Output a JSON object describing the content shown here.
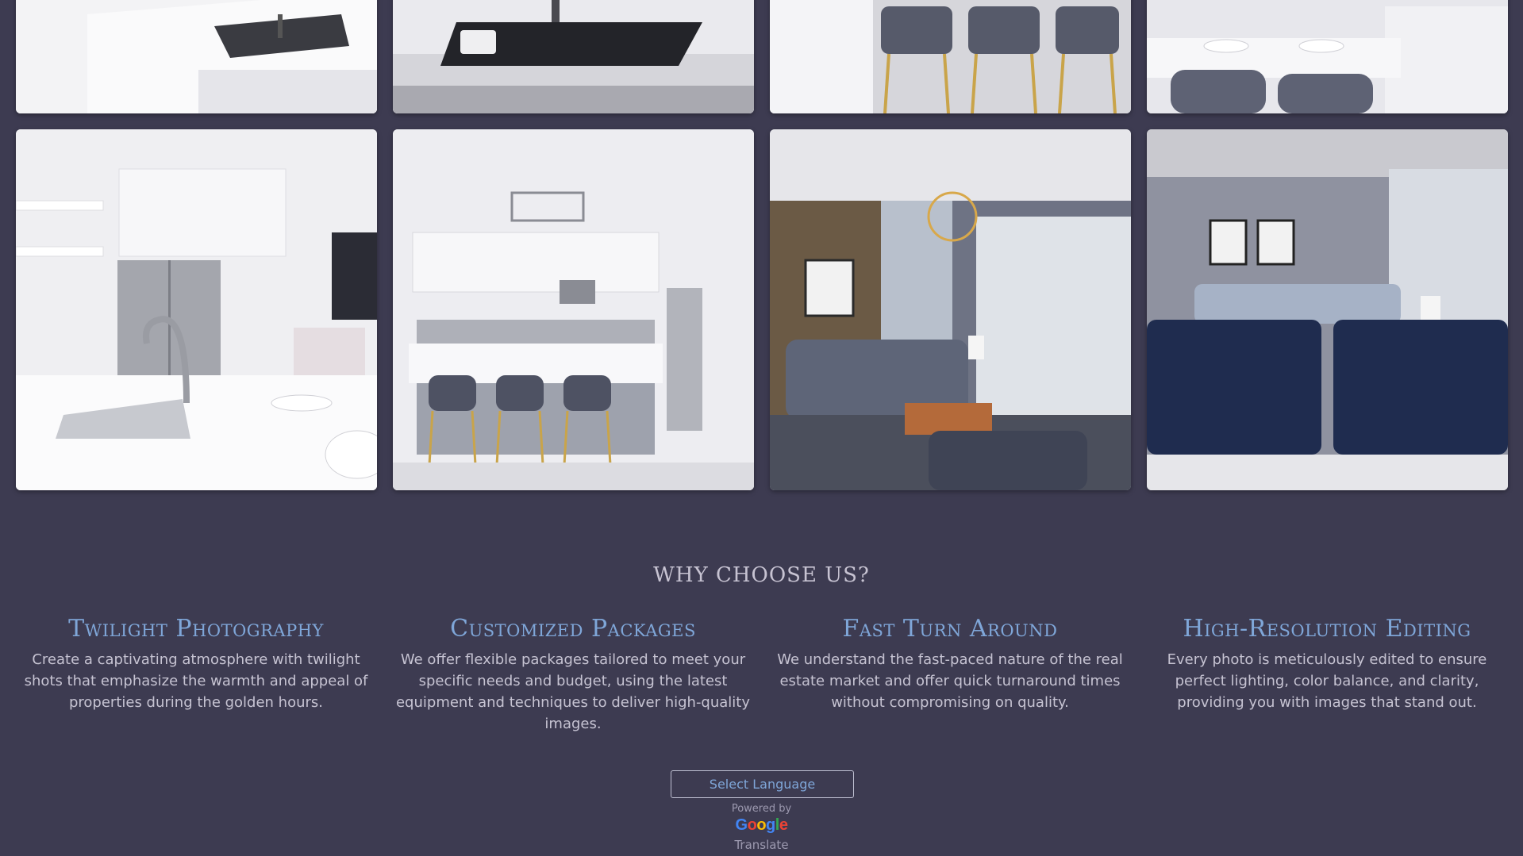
{
  "gallery": {
    "photos": [
      {
        "name": "kitchen-island-sink-photo"
      },
      {
        "name": "kitchen-sink-closeup-photo"
      },
      {
        "name": "bar-stools-photo"
      },
      {
        "name": "dining-counter-photo"
      },
      {
        "name": "kitchen-faucet-photo"
      },
      {
        "name": "white-kitchen-photo"
      },
      {
        "name": "living-room-chandelier-photo"
      },
      {
        "name": "navy-sofa-living-room-photo"
      }
    ]
  },
  "why": {
    "heading": "WHY CHOOSE US?",
    "features": [
      {
        "title": "Twilight Photography",
        "text": "Create a captivating atmosphere with twilight shots that emphasize the warmth and appeal of properties during the golden hours."
      },
      {
        "title": "Customized Packages",
        "text": "We offer flexible packages tailored to meet your specific needs and budget, using the latest equipment and techniques to deliver high-quality images."
      },
      {
        "title": "Fast Turn Around",
        "text": "We understand the fast-paced nature of the real estate market and offer quick turnaround times without compromising on quality."
      },
      {
        "title": "High-Resolution Editing",
        "text": "Every photo is meticulously edited to ensure perfect lighting, color balance, and clarity, providing you with images that stand out."
      }
    ]
  },
  "translate": {
    "select_label": "Select Language",
    "powered_by": "Powered by",
    "google_letters": [
      "G",
      "o",
      "o",
      "g",
      "l",
      "e"
    ],
    "translate_word": "Translate"
  },
  "colors": {
    "background": "#3d3b51",
    "accent_blue": "#7fa6d8",
    "body_text": "#c6c3d2"
  }
}
